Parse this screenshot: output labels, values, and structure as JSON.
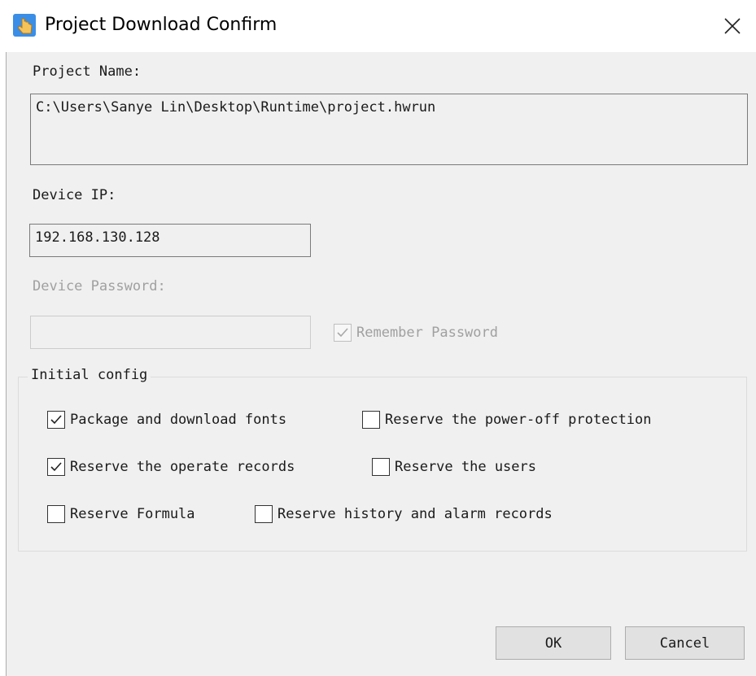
{
  "window": {
    "title": "Project Download Confirm",
    "icon": "hand-pointer-app-icon",
    "close_icon": "close-icon"
  },
  "project": {
    "label": "Project Name:",
    "value": "C:\\Users\\Sanye Lin\\Desktop\\Runtime\\project.hwrun"
  },
  "device_ip": {
    "label": "Device IP:",
    "value": "192.168.130.128"
  },
  "device_password": {
    "label": "Device Password:",
    "value": "",
    "remember_label": "Remember Password",
    "remember_checked": true,
    "enabled": false
  },
  "initial_config": {
    "legend": "Initial config",
    "options": [
      {
        "label": "Package and download fonts",
        "checked": true
      },
      {
        "label": "Reserve the power-off protection",
        "checked": false
      },
      {
        "label": "Reserve the operate records",
        "checked": true
      },
      {
        "label": "Reserve the users",
        "checked": false
      },
      {
        "label": "Reserve Formula",
        "checked": false
      },
      {
        "label": "Reserve history and alarm records",
        "checked": false
      }
    ]
  },
  "buttons": {
    "ok": "OK",
    "cancel": "Cancel"
  }
}
